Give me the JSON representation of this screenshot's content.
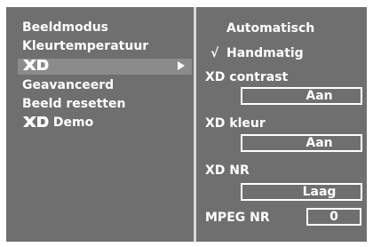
{
  "left_menu": {
    "items": [
      {
        "label": "Beeldmodus"
      },
      {
        "label": "Kleurtemperatuur"
      },
      {
        "label": "XD",
        "is_logo": true
      },
      {
        "label": "Geavanceerd"
      },
      {
        "label": "Beeld resetten"
      },
      {
        "label": "Demo",
        "logo_prefix": "XD"
      }
    ],
    "selected_index": 2
  },
  "right_panel": {
    "option_auto": "Automatisch",
    "option_manual": "Handmatig",
    "manual_checked": true,
    "check_glyph": "√",
    "xd_contrast_label": "XD contrast",
    "xd_contrast_value": "Aan",
    "xd_color_label": "XD kleur",
    "xd_color_value": "Aan",
    "xd_nr_label": "XD NR",
    "xd_nr_value": "Laag",
    "mpeg_nr_label": "MPEG NR",
    "mpeg_nr_value": "0"
  },
  "icons": {
    "arrow": "play-right-icon",
    "logo": "xd-logo-icon",
    "check": "checkmark-icon"
  },
  "colors": {
    "panel_bg": "#6f6f6f",
    "highlight_bg": "#8b8b8b",
    "divider": "#d9d9d9",
    "text": "#ffffff"
  }
}
